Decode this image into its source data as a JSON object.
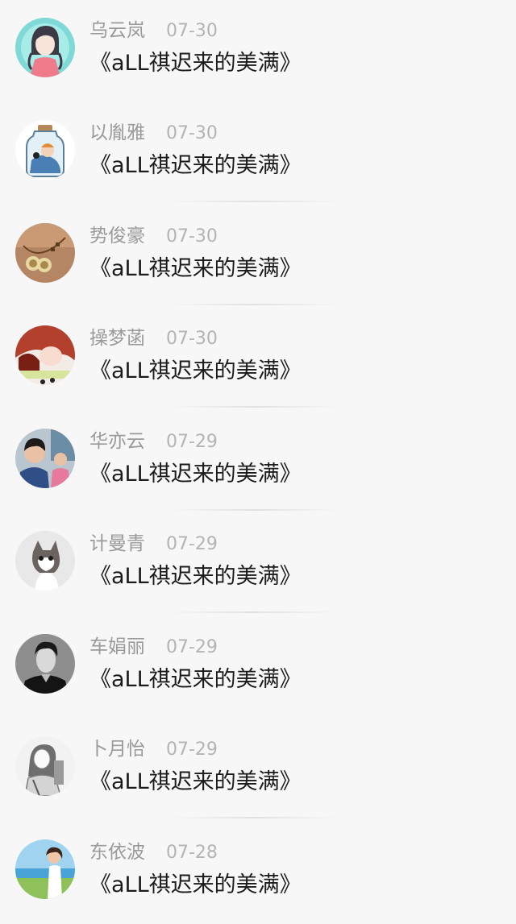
{
  "feed": {
    "items": [
      {
        "name": "乌云岚",
        "date": "07-30",
        "title": "《aLL祺迟来的美满》",
        "avatar": "anime-girl-avatar"
      },
      {
        "name": "以胤雅",
        "date": "07-30",
        "title": "《aLL祺迟来的美满》",
        "avatar": "jar-avatar"
      },
      {
        "name": "势俊豪",
        "date": "07-30",
        "title": "《aLL祺迟来的美满》",
        "avatar": "bells-avatar"
      },
      {
        "name": "操梦菡",
        "date": "07-30",
        "title": "《aLL祺迟来的美满》",
        "avatar": "redhead-girl-avatar"
      },
      {
        "name": "华亦云",
        "date": "07-29",
        "title": "《aLL祺迟来的美满》",
        "avatar": "kids-photo-avatar"
      },
      {
        "name": "计曼青",
        "date": "07-29",
        "title": "《aLL祺迟来的美满》",
        "avatar": "cat-avatar"
      },
      {
        "name": "车娟丽",
        "date": "07-29",
        "title": "《aLL祺迟来的美满》",
        "avatar": "man-portrait-avatar"
      },
      {
        "name": "卜月怡",
        "date": "07-29",
        "title": "《aLL祺迟来的美满》",
        "avatar": "sketch-girl-avatar"
      },
      {
        "name": "东依波",
        "date": "07-28",
        "title": "《aLL祺迟来的美满》",
        "avatar": "beach-girl-avatar"
      }
    ]
  },
  "colors": {
    "background": "#f7f7f7",
    "name_text": "#9a9a9a",
    "date_text": "#b4b4b4",
    "title_text": "#1b1b1b"
  }
}
